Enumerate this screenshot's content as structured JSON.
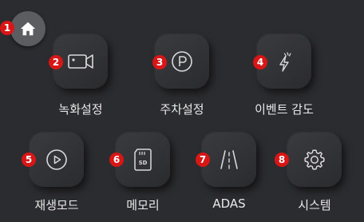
{
  "home": {
    "icon": "home-icon"
  },
  "items": [
    {
      "badge": "1",
      "icon": "home-icon"
    },
    {
      "badge": "2",
      "label": "녹화설정",
      "icon": "camera-icon"
    },
    {
      "badge": "3",
      "label": "주차설정",
      "icon": "parking-icon"
    },
    {
      "badge": "4",
      "label": "이벤트 감도",
      "icon": "lightning-icon"
    },
    {
      "badge": "5",
      "label": "재생모드",
      "icon": "play-icon"
    },
    {
      "badge": "6",
      "label": "메모리",
      "icon": "sd-card-icon",
      "icon_text": "SD"
    },
    {
      "badge": "7",
      "label": "ADAS",
      "icon": "lane-icon"
    },
    {
      "badge": "8",
      "label": "시스템",
      "icon": "gear-icon"
    }
  ],
  "colors": {
    "background": "#2b2c2f",
    "badge": "#d81616",
    "icon": "#d9d9d9"
  }
}
